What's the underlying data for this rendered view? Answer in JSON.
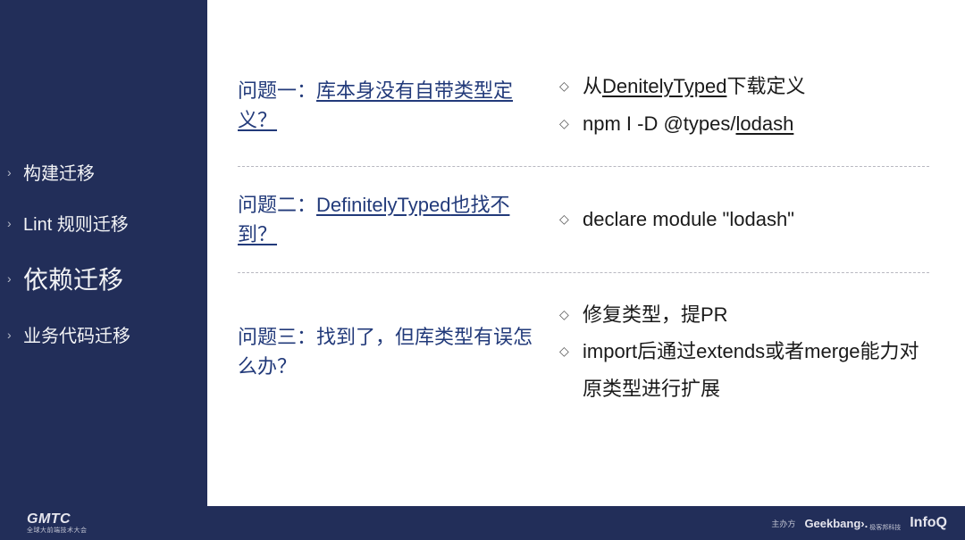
{
  "sidebar": {
    "items": [
      {
        "label": "构建迁移",
        "active": false
      },
      {
        "label": "Lint 规则迁移",
        "active": false
      },
      {
        "label": "依赖迁移",
        "active": true
      },
      {
        "label": "业务代码迁移",
        "active": false
      }
    ]
  },
  "questions": [
    {
      "prefix": "问题一：",
      "text": "库本身没有自带类型定义？",
      "answers": [
        {
          "pre": "从",
          "ul": "DenitelyTyped",
          "post": "下载定义"
        },
        {
          "pre": "npm I -D @types/",
          "ul": "lodash",
          "post": ""
        }
      ]
    },
    {
      "prefix": "问题二：",
      "ul": "DefinitelyTyped",
      "text": "也找不到？",
      "answers": [
        {
          "pre": "declare module \"lodash\"",
          "ul": "",
          "post": ""
        }
      ]
    },
    {
      "prefix": "问题三：",
      "text": "找到了，但库类型有误怎么办？",
      "answers": [
        {
          "pre": "修复类型，提PR",
          "ul": "",
          "post": ""
        },
        {
          "pre": "import后通过extends或者merge能力对原类型进行扩展",
          "ul": "",
          "post": ""
        }
      ]
    }
  ],
  "footer": {
    "brand": "GMTC",
    "brand_sub": "全球大前端技术大会",
    "org_label": "主办方",
    "sponsor1": "Geekbang›.",
    "sponsor1_sub": "极客邦科技",
    "sponsor2": "InfoQ"
  }
}
